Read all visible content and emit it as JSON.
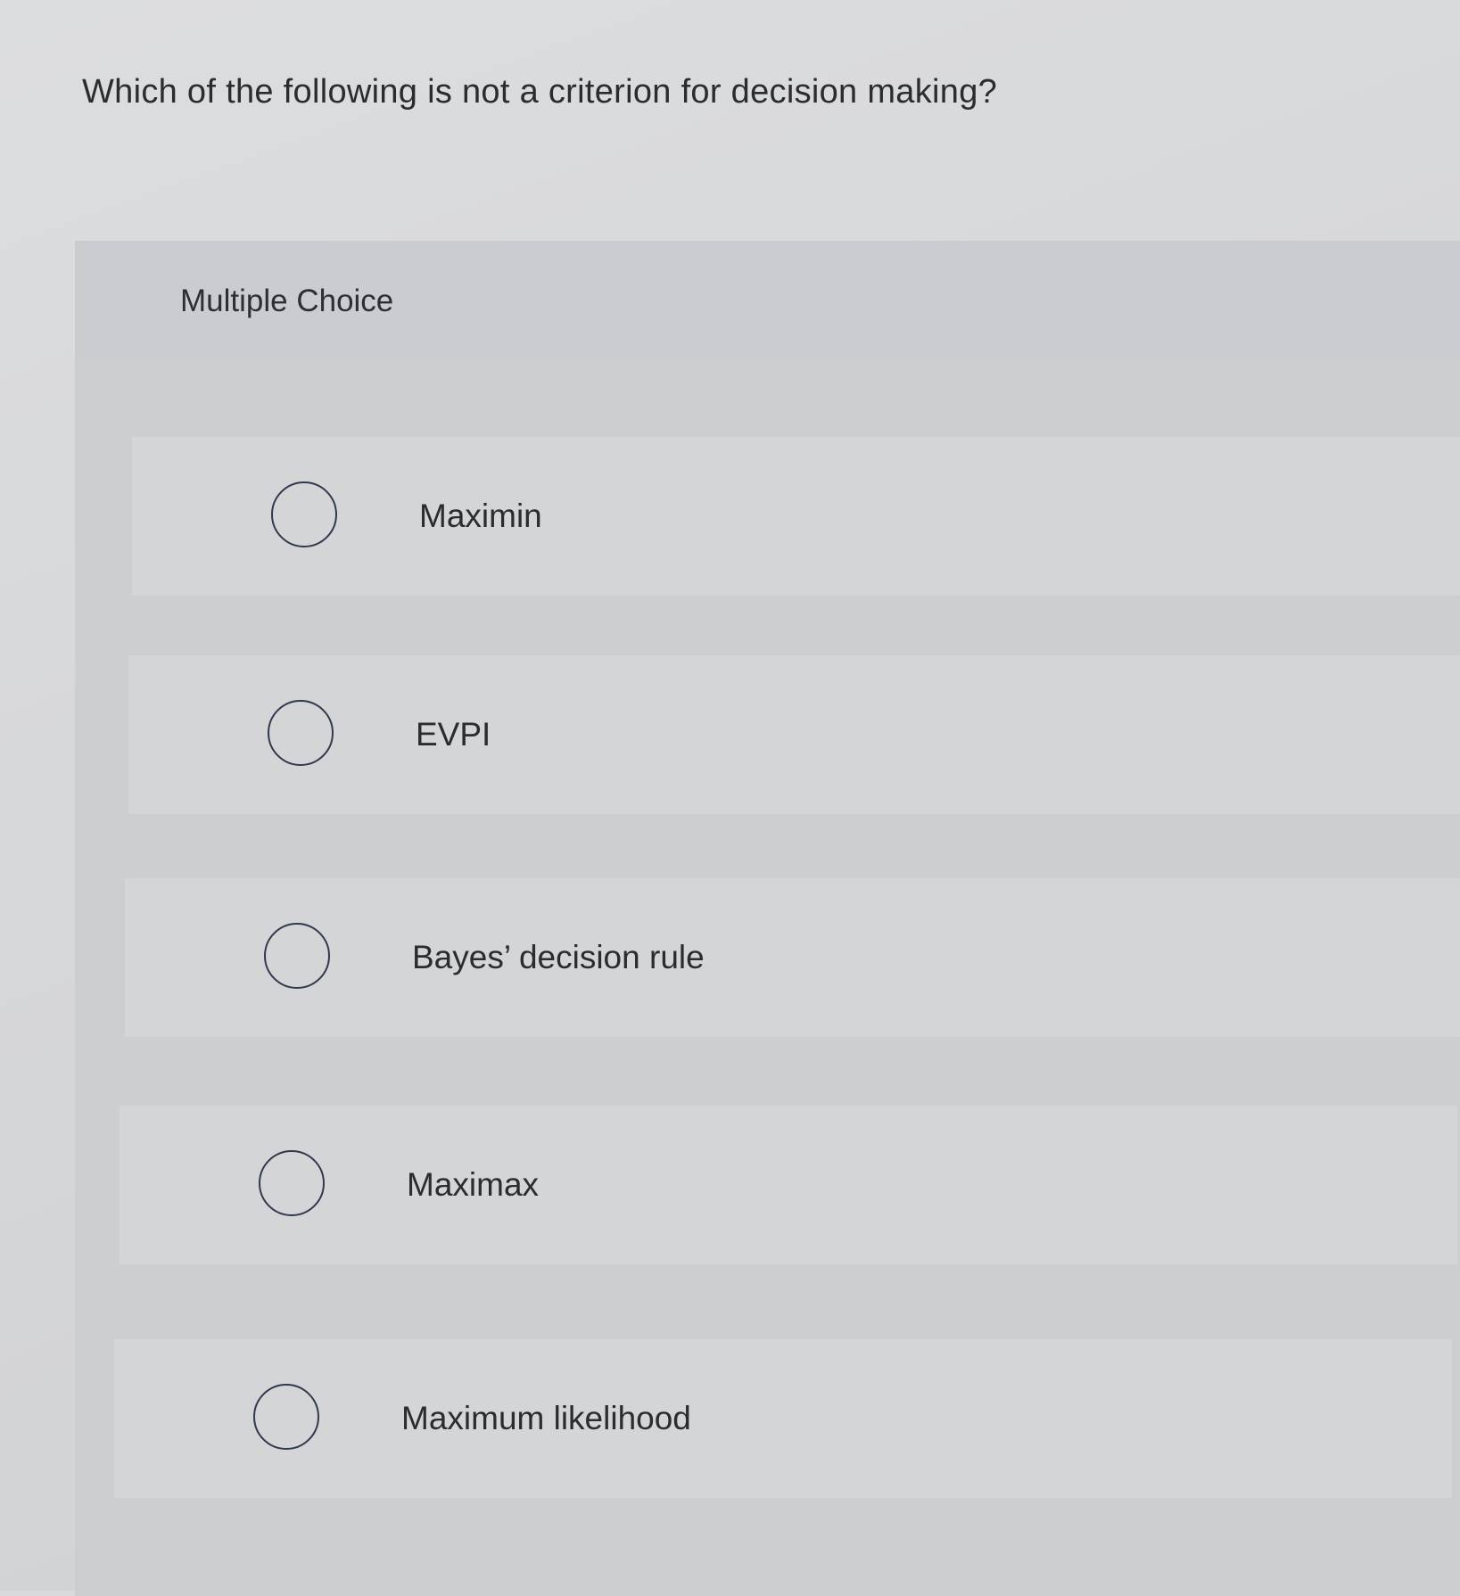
{
  "question": {
    "text": "Which of the following is not a criterion for decision making?"
  },
  "multiple_choice": {
    "label": "Multiple Choice",
    "options": [
      {
        "label": "Maximin",
        "selected": false
      },
      {
        "label": "EVPI",
        "selected": false
      },
      {
        "label": "Bayes’ decision rule",
        "selected": false
      },
      {
        "label": "Maximax",
        "selected": false
      },
      {
        "label": "Maximum likelihood",
        "selected": false
      }
    ]
  }
}
